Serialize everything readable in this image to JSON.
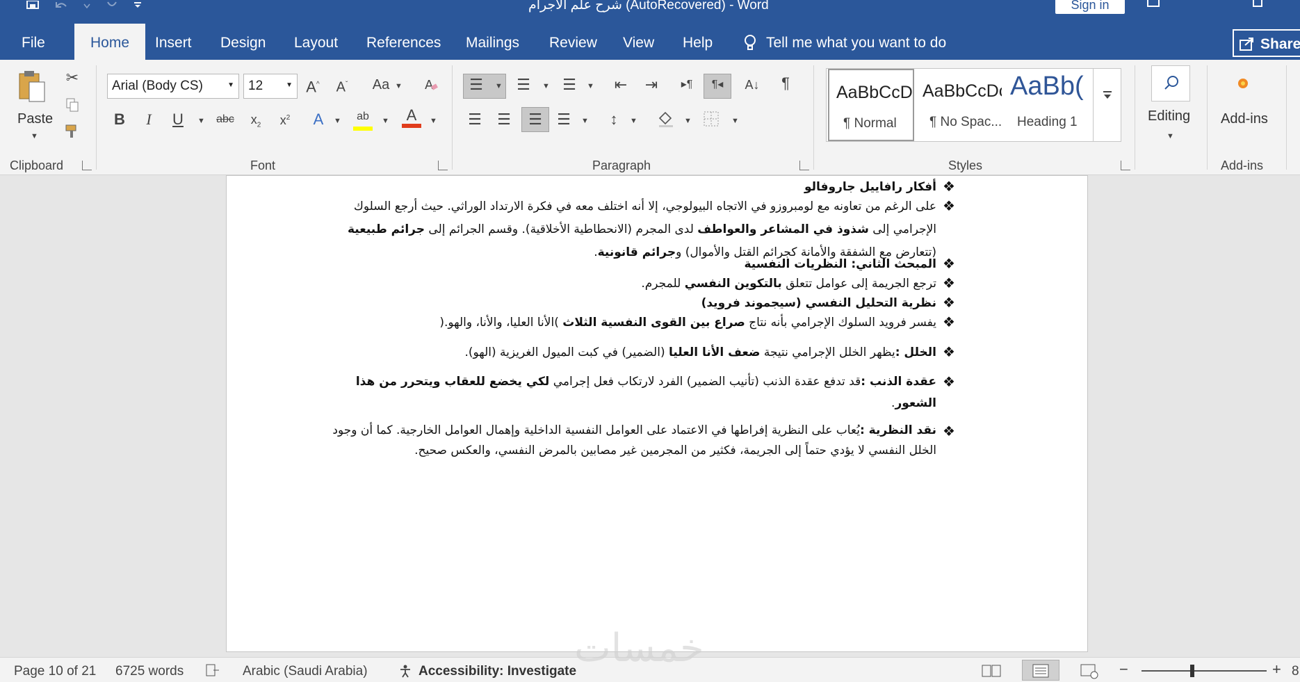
{
  "titlebar": {
    "title": "شرح علم الاجرام (AutoRecovered)  -  Word",
    "signin_label": "Sign in",
    "qat_icons": [
      "save-icon",
      "undo-icon",
      "redo-icon",
      "customize-icon"
    ]
  },
  "tabs": [
    {
      "label": "File"
    },
    {
      "label": "Home"
    },
    {
      "label": "Insert"
    },
    {
      "label": "Design"
    },
    {
      "label": "Layout"
    },
    {
      "label": "References"
    },
    {
      "label": "Mailings"
    },
    {
      "label": "Review"
    },
    {
      "label": "View"
    },
    {
      "label": "Help"
    }
  ],
  "tellme": {
    "label": "Tell me what you want to do"
  },
  "share": {
    "label": "Share"
  },
  "clipboard": {
    "paste_label": "Paste",
    "group_label": "Clipboard"
  },
  "font": {
    "font_name": "Arial (Body CS)",
    "font_size": "12",
    "group_label": "Font",
    "case_label": "Aa"
  },
  "paragraph": {
    "group_label": "Paragraph"
  },
  "styles": {
    "group_label": "Styles",
    "items": [
      {
        "sample": "AaBbCcDc",
        "name": "¶ Normal"
      },
      {
        "sample": "AaBbCcDc",
        "name": "¶ No Spac..."
      },
      {
        "sample": "AaBb(",
        "name": "Heading 1"
      }
    ]
  },
  "editing": {
    "label": "Editing"
  },
  "addins": {
    "label": "Add-ins",
    "group_label": "Add-ins"
  },
  "document": {
    "p1": {
      "bold": "أفكار رافاييل جاروفالو"
    },
    "p2": {
      "t1": "على الرغم من تعاونه مع لومبروزو في الاتجاه البيولوجي، إلا أنه اختلف معه في فكرة الارتداد الوراثي. حيث أرجع السلوك الإجرامي إلى ",
      "b1": "شذوذ في المشاعر والعواطف",
      "t2": " لدى المجرم (الانحطاطية الأخلاقية). وقسم الجرائم إلى ",
      "b2": "جرائم طبيعية",
      "t3": " (تتعارض مع الشفقة والأمانة كجرائم القتل والأموال) و",
      "b3": "جرائم قانونية",
      "t4": "."
    },
    "p3": {
      "bold": "المبحث الثاني: النظريات النفسية"
    },
    "p4": {
      "t1": "ترجع الجريمة إلى عوامل تتعلق ",
      "b1": "بالتكوين النفسي",
      "t2": " للمجرم."
    },
    "p5": {
      "bold": "نظرية التحليل النفسي (سيجموند فرويد)"
    },
    "p6": {
      "t1": "يفسر فرويد السلوك الإجرامي بأنه نتاج ",
      "b1": "صراع بين القوى النفسية الثلاث",
      "t2": " )الأنا العليا، والأنا، والهو.("
    },
    "p7": {
      "b1": "الخلل :",
      "t1": "يظهر الخلل الإجرامي نتيجة ",
      "b2": "ضعف الأنا العليا",
      "t2": " (الضمير) في كبت الميول الغريزية (الهو)."
    },
    "p8": {
      "b1": "عقدة الذنب :",
      "t1": "قد تدفع عقدة الذنب (تأنيب الضمير) الفرد لارتكاب فعل إجرامي ",
      "b2": "لكي يخضع للعقاب ويتحرر من هذا الشعور",
      "t2": "."
    },
    "p9": {
      "b1": "نقد النظرية :",
      "t1": "يُعاب على النظرية إفراطها في الاعتماد على العوامل النفسية الداخلية وإهمال العوامل الخارجية. كما أن وجود الخلل النفسي لا يؤدي حتماً إلى الجريمة، فكثير من المجرمين غير مصابين بالمرض النفسي، والعكس صحيح."
    }
  },
  "status": {
    "page": "Page 10 of 21",
    "words": "6725 words",
    "language": "Arabic (Saudi Arabia)",
    "accessibility": "Accessibility: Investigate",
    "zoom": "8"
  },
  "watermark": {
    "text": "خمسات"
  }
}
